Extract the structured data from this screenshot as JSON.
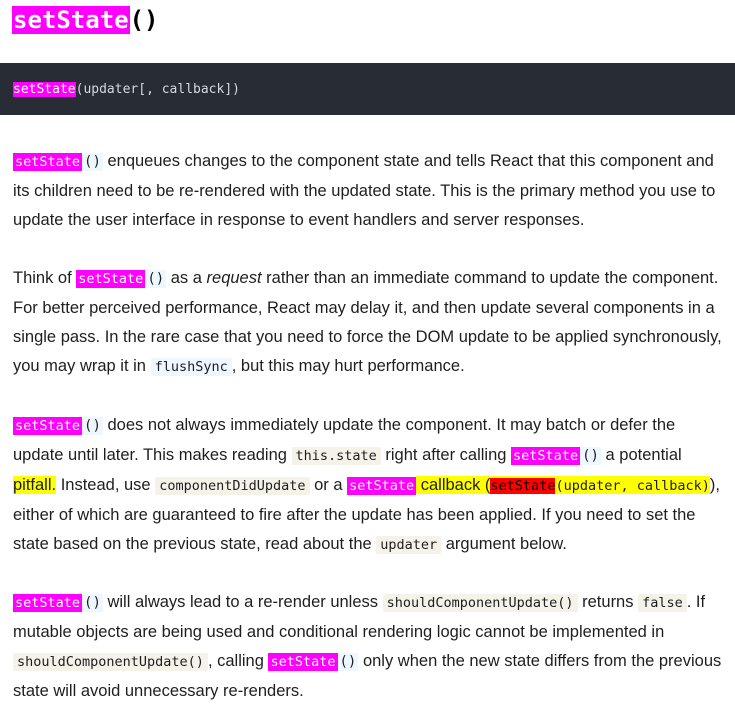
{
  "heading": {
    "tag": "setState",
    "parens": "()"
  },
  "signature": {
    "fn": "setState",
    "args": "(updater[, callback])"
  },
  "p1": {
    "tag": "setState",
    "parens": "()",
    "text": " enqueues changes to the component state and tells React that this component and its children need to be re-rendered with the updated state. This is the primary method you use to update the user interface in response to event handlers and server responses."
  },
  "p2": {
    "t1": "Think of ",
    "tag": "setState",
    "parens": "()",
    "t2": " as a ",
    "em": "request",
    "t3": " rather than an immediate command to update the component. For better perceived performance, React may delay it, and then update several components in a single pass. In the rare case that you need to force the DOM update to be applied synchronously, you may wrap it in ",
    "code": "flushSync",
    "t4": ", but this may hurt performance."
  },
  "p3": {
    "tag1": "setState",
    "parens1": "()",
    "t1": " does not always immediately update the component. It may batch or defer the update until later. This makes reading ",
    "code1": "this.state",
    "t2": " right after calling ",
    "tag2": "setState",
    "parens2": "()",
    "t3": " a potential ",
    "pitfall": "pitfall.",
    "t4": " Instead, use ",
    "code2": "componentDidUpdate",
    "t5": " or a ",
    "tag3": "setState",
    "t6": " callback (",
    "tag4": "setState",
    "code3": "(updater, callback)",
    "t7": "), either of which are guaranteed to fire after the update has been applied. If you need to set the state based on the previous state, read about the ",
    "code4": "updater",
    "t8": " argument below."
  },
  "p4": {
    "tag1": "setState",
    "parens1": "()",
    "t1": " will always lead to a re-render unless ",
    "code1": "shouldComponentUpdate()",
    "t2": " returns ",
    "code2": "false",
    "t3": ". If mutable objects are being used and conditional rendering logic cannot be implemented in ",
    "code3": "shouldComponentUpdate()",
    "t4": ", calling ",
    "tag2": "setState",
    "parens2": "()",
    "t5": " only when the new state differs from the previous state will avoid unnecessary re-renders."
  },
  "colors": {
    "highlight_magenta": "#ff00ff",
    "highlight_yellow": "#ffff00",
    "highlight_red": "#ff0000",
    "code_bg": "#282c34"
  }
}
